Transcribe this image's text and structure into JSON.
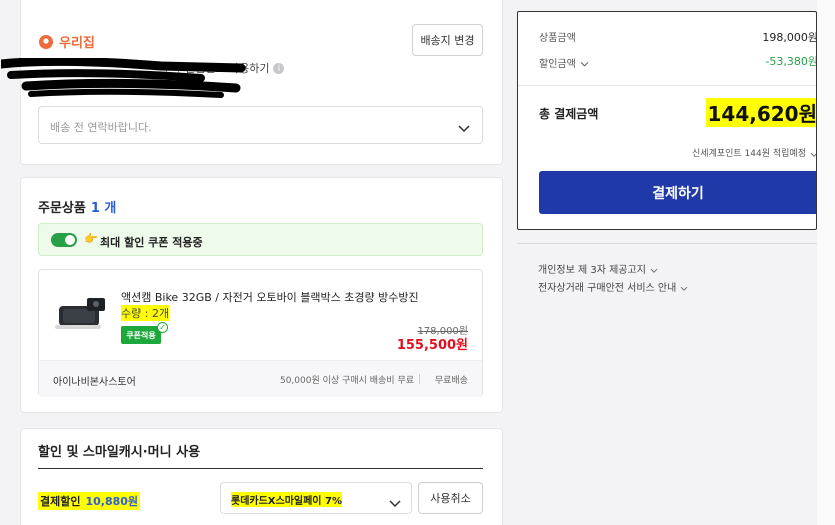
{
  "shipping": {
    "address_name": "우리집",
    "change_button": "배송지 변경",
    "safe_number_label": "안심번호 사용하기",
    "memo_placeholder": "배송 전 연락바랍니다."
  },
  "products": {
    "title": "주문상품",
    "count": "1 개",
    "coupon_text": "최대 할인 쿠폰 적용중",
    "item": {
      "name": "액션캠 Bike 32GB / 자전거 오토바이 블랙박스 초경량 방수방진",
      "quantity": "수량 : 2개",
      "coupon_badge": "쿠폰적용",
      "original_price": "178,000원",
      "sale_price": "155,500원"
    },
    "seller": "아이나비본사스토어",
    "shipping_info": "50,000원 이상 구매시 배송비 무료",
    "shipping_fee": "무료배송"
  },
  "discount": {
    "title": "할인 및 스마일캐시·머니 사용",
    "payment_discount_label": "결제할인",
    "payment_discount_value": "10,880원",
    "card_option": "롯데카드X스마일페이 7%",
    "cancel_button": "사용취소"
  },
  "summary": {
    "product_amount_label": "상품금액",
    "product_amount_value": "198,000원",
    "discount_label": "할인금액",
    "discount_value": "-53,380원",
    "total_label": "총 결제금액",
    "total_value": "144,620원",
    "points_text": "신세계포인트 144원 적립예정",
    "pay_button": "결제하기"
  },
  "notices": {
    "privacy": "개인정보 제 3자 제공고지",
    "safety": "전자상거래 구매안전 서비스 안내"
  },
  "colors": {
    "accent_blue": "#2c5cd8",
    "pay_button": "#1f3aa8",
    "discount_green": "#27a046",
    "sale_red": "#e0101f",
    "highlight": "#ffff00",
    "pin_orange": "#ef6b3b"
  },
  "icons": {
    "pin": "location-pin-icon",
    "chevron": "chevron-down-icon",
    "toggle": "toggle-switch-icon",
    "hand": "pointing-hand-icon",
    "info": "info-icon",
    "check": "check-icon"
  }
}
